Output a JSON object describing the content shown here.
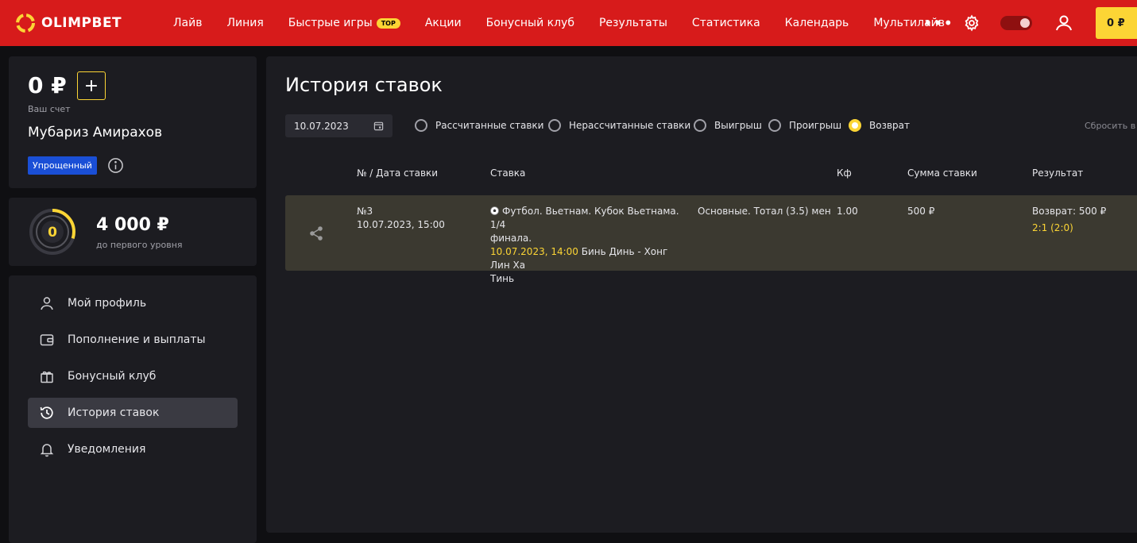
{
  "header": {
    "logo_text": "OLIMPBET",
    "nav": [
      {
        "label": "Лайв"
      },
      {
        "label": "Линия"
      },
      {
        "label": "Быстрые игры",
        "badge": "TOP"
      },
      {
        "label": "Акции"
      },
      {
        "label": "Бонусный клуб"
      },
      {
        "label": "Результаты"
      },
      {
        "label": "Статистика"
      },
      {
        "label": "Календарь"
      },
      {
        "label": "Мультилайв"
      }
    ],
    "more": "•••",
    "balance": "0 ₽"
  },
  "account": {
    "balance": "0 ₽",
    "plus": "+",
    "label": "Ваш счет",
    "name": "Мубариз Амирахов",
    "status_badge": "Упрощенный"
  },
  "level": {
    "current": "0",
    "progress": 0.3,
    "amount": "4 000 ₽",
    "label": "до первого уровня"
  },
  "menu": [
    {
      "label": "Мой профиль",
      "icon": "user-icon"
    },
    {
      "label": "Пополнение и выплаты",
      "icon": "wallet-icon"
    },
    {
      "label": "Бонусный клуб",
      "icon": "gift-icon"
    },
    {
      "label": "История ставок",
      "icon": "history-icon",
      "active": true
    },
    {
      "label": "Уведомления",
      "icon": "bell-icon"
    }
  ],
  "main": {
    "title": "История ставок",
    "date": "10.07.2023",
    "filters": [
      {
        "label": "Рассчитанные ставки",
        "checked": false
      },
      {
        "label": "Нерассчитанные ставки",
        "checked": false
      },
      {
        "label": "Выигрыш",
        "checked": false
      },
      {
        "label": "Проигрыш",
        "checked": false
      },
      {
        "label": "Возврат",
        "checked": true
      }
    ],
    "reset": "Сбросить в",
    "columns": [
      "№ / Дата ставки",
      "Ставка",
      "Кф",
      "Сумма ставки",
      "Результат"
    ],
    "rows": [
      {
        "number": "№3",
        "date": "10.07.2023, 15:00",
        "event_line1": "Футбол. Вьетнам. Кубок Вьетнама. 1/4",
        "event_line2": "финала.",
        "event_time": "10.07.2023, 14:00",
        "match_part1": "Бинь Динь - Хонг Лин Ха",
        "match_part2": "Тинь",
        "market": "Основные. Тотал (3.5) мен",
        "odds": "1.00",
        "stake": "500 ₽",
        "result": "Возврат: 500 ₽",
        "score": "2:1 (2:0)"
      }
    ]
  },
  "colors": {
    "brand_red": "#d71b1b",
    "accent_yellow": "#fcd535",
    "badge_blue": "#1a4fd6",
    "panel": "#1c1c21",
    "row_bg": "#3b3930"
  }
}
